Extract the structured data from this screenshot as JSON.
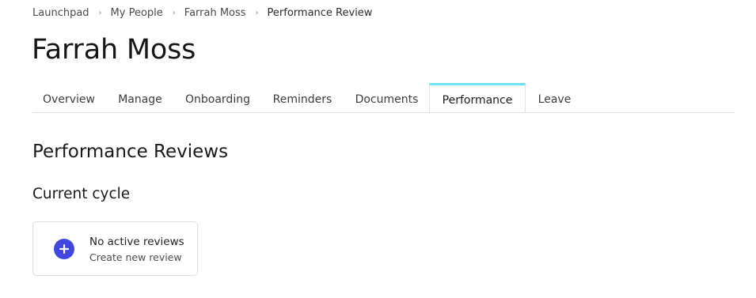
{
  "breadcrumb": {
    "items": [
      "Launchpad",
      "My People",
      "Farrah Moss"
    ],
    "current": "Performance Review",
    "separator": "›"
  },
  "page": {
    "title": "Farrah Moss"
  },
  "tabs": [
    {
      "label": "Overview",
      "active": false
    },
    {
      "label": "Manage",
      "active": false
    },
    {
      "label": "Onboarding",
      "active": false
    },
    {
      "label": "Reminders",
      "active": false
    },
    {
      "label": "Documents",
      "active": false
    },
    {
      "label": "Performance",
      "active": true
    },
    {
      "label": "Leave",
      "active": false
    }
  ],
  "performance": {
    "section_title": "Performance Reviews",
    "current_cycle_title": "Current cycle",
    "card": {
      "title": "No active reviews",
      "subtitle": "Create new review",
      "icon": "plus-circle-icon"
    }
  },
  "colors": {
    "active_tab_accent": "#6fe3f2",
    "plus_icon": "#4146e0",
    "border": "#e2e2e2"
  }
}
